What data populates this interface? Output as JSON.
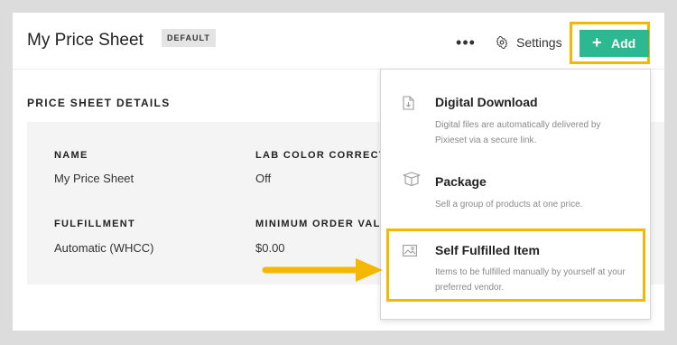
{
  "header": {
    "title": "My Price Sheet",
    "badge": "DEFAULT",
    "more_label": "•••",
    "settings_label": "Settings",
    "add_label": "Add",
    "add_plus": "+"
  },
  "details": {
    "heading": "PRICE SHEET DETAILS",
    "fields": [
      {
        "label": "NAME",
        "value": "My Price Sheet"
      },
      {
        "label": "LAB COLOR CORRECTION",
        "value": "Off"
      },
      {
        "label": "FULFILLMENT",
        "value": "Automatic (WHCC)"
      },
      {
        "label": "MINIMUM ORDER VALUE",
        "value": "$0.00"
      }
    ]
  },
  "add_menu": {
    "items": [
      {
        "title": "Digital Download",
        "description": "Digital files are automatically delivered by Pixieset via a secure link.",
        "icon": "document-download-icon"
      },
      {
        "title": "Package",
        "description": "Sell a group of products at one price.",
        "icon": "box-icon"
      },
      {
        "title": "Self Fulfilled Item",
        "description": "Items to be fulfilled manually by yourself at your preferred vendor.",
        "icon": "image-icon"
      }
    ]
  },
  "colors": {
    "accent": "#2cb890",
    "highlight": "#f5b800",
    "panel_bg": "#f4f4f4"
  }
}
